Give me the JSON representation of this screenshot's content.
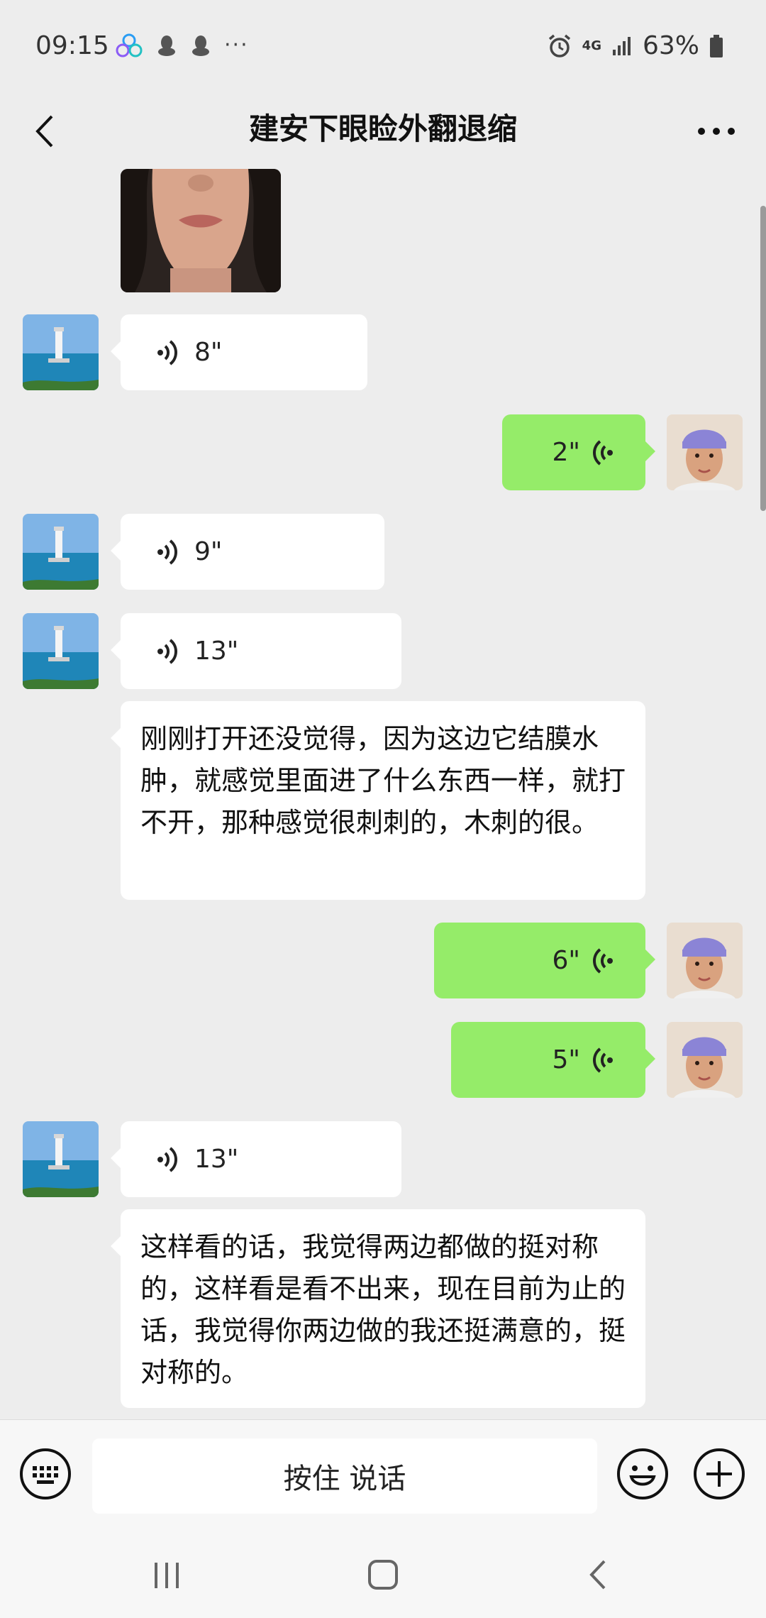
{
  "status_bar": {
    "time": "09:15",
    "network": "4G",
    "battery": "63%",
    "more": "···"
  },
  "header": {
    "title": "建安下眼睑外翻退缩",
    "back_icon": "chevron-left-icon",
    "more_icon": "more-horizontal-icon"
  },
  "messages": [
    {
      "type": "image",
      "direction": "in"
    },
    {
      "type": "voice",
      "direction": "in",
      "duration": "8\""
    },
    {
      "type": "voice",
      "direction": "out",
      "duration": "2\""
    },
    {
      "type": "voice",
      "direction": "in",
      "duration": "9\""
    },
    {
      "type": "voice",
      "direction": "in",
      "duration": "13\""
    },
    {
      "type": "text",
      "direction": "in",
      "text": "刚刚打开还没觉得，因为这边它结膜水肿，就感觉里面进了什么东西一样，就打不开，那种感觉很刺刺的，木刺的很。"
    },
    {
      "type": "voice",
      "direction": "out",
      "duration": "6\""
    },
    {
      "type": "voice",
      "direction": "out",
      "duration": "5\""
    },
    {
      "type": "voice",
      "direction": "in",
      "duration": "13\""
    },
    {
      "type": "text",
      "direction": "in",
      "text": "这样看的话，我觉得两边都做的挺对称的，这样看是看不出来，现在目前为止的话，我觉得你两边做的我还挺满意的，挺对称的。"
    }
  ],
  "input_bar": {
    "hold_to_talk": "按住 说话",
    "keyboard_icon": "keyboard-icon",
    "emoji_icon": "emoji-icon",
    "plus_icon": "plus-circle-icon"
  },
  "colors": {
    "background": "#ededed",
    "outgoing_bubble": "#95ec69",
    "incoming_bubble": "#ffffff"
  }
}
